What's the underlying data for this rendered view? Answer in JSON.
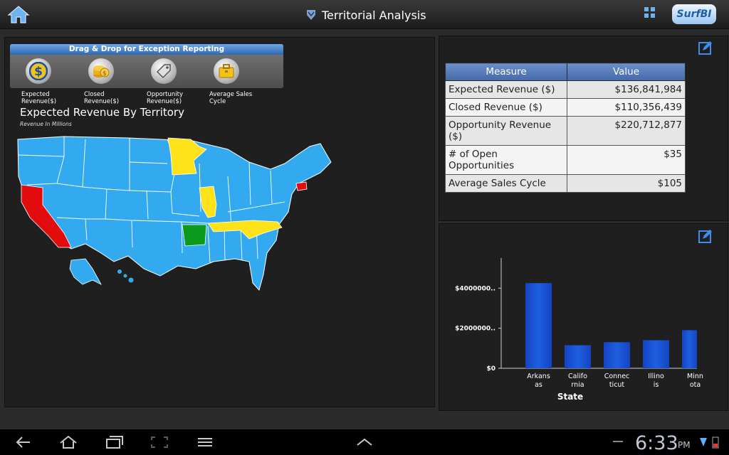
{
  "header": {
    "title": "Territorial Analysis",
    "logo_text": "SurfBI"
  },
  "exception": {
    "title": "Drag & Drop for Exception Reporting",
    "items": [
      {
        "label_line1": "Expected",
        "label_line2": "Revenue($)",
        "icon": "dollar-icon"
      },
      {
        "label_line1": "Closed",
        "label_line2": "Revenue($)",
        "icon": "coins-icon"
      },
      {
        "label_line1": "Opportunity",
        "label_line2": "Revenue($)",
        "icon": "tag-icon"
      },
      {
        "label_line1": "Average Sales",
        "label_line2": "Cycle",
        "icon": "briefcase-icon"
      }
    ]
  },
  "map": {
    "title": "Expected Revenue By Territory",
    "subtitle": "Revenue In Millions",
    "colors": {
      "default": "#33aaf0",
      "highlight_yellow": "#ffe31a",
      "highlight_red": "#e20c0c",
      "highlight_green": "#0c9a1c"
    }
  },
  "measures": {
    "headers": [
      "Measure",
      "Value"
    ],
    "rows": [
      {
        "measure": "Expected Revenue ($)",
        "value": "$136,841,984"
      },
      {
        "measure": "Closed Revenue ($)",
        "value": "$110,356,439"
      },
      {
        "measure": "Opportunity Revenue ($)",
        "value": "$220,712,877"
      },
      {
        "measure": "# of Open Opportunities",
        "value": "$35"
      },
      {
        "measure": "Average Sales Cycle",
        "value": "$105"
      }
    ]
  },
  "chart_data": {
    "type": "bar",
    "categories": [
      "Arkansas",
      "California",
      "Connecticut",
      "Illinois",
      "Minnesota"
    ],
    "category_labels": [
      [
        "Arkans",
        "as"
      ],
      [
        "Califo",
        "rnia"
      ],
      [
        "Connec",
        "ticut"
      ],
      [
        "Illino",
        "is"
      ],
      [
        "Minn",
        "ota"
      ]
    ],
    "values": [
      42500000,
      11500000,
      13000000,
      14000000,
      19000000
    ],
    "xlabel": "State",
    "ylabel": "",
    "ylim": [
      0,
      55000000
    ],
    "yticks": [
      0,
      20000000,
      40000000
    ],
    "ytick_labels": [
      "$0",
      "$2000000..",
      "$4000000.."
    ],
    "bar_color": "#1d5fe0"
  },
  "statusbar": {
    "time": "6:33",
    "ampm": "PM"
  }
}
